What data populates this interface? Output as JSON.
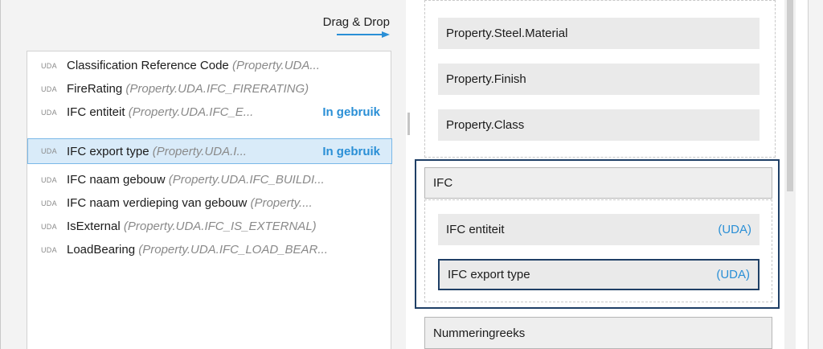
{
  "left_panel": {
    "drag_drop_label": "Drag & Drop",
    "items": [
      {
        "tag": "UDA",
        "name": "Classification Reference Code",
        "prop": " (Property.UDA...",
        "status": ""
      },
      {
        "tag": "UDA",
        "name": "FireRating",
        "prop": " (Property.UDA.IFC_FIRERATING)",
        "status": ""
      },
      {
        "tag": "UDA",
        "name": "IFC entiteit",
        "prop": " (Property.UDA.IFC_E...",
        "status": "In gebruik"
      },
      {
        "tag": "UDA",
        "name": "IFC export type",
        "prop": " (Property.UDA.I...",
        "status": "In gebruik",
        "selected": true
      },
      {
        "tag": "UDA",
        "name": "IFC naam gebouw",
        "prop": " (Property.UDA.IFC_BUILDI...",
        "status": ""
      },
      {
        "tag": "UDA",
        "name": "IFC naam verdieping van gebouw",
        "prop": " (Property....",
        "status": ""
      },
      {
        "tag": "UDA",
        "name": "IsExternal",
        "prop": " (Property.UDA.IFC_IS_EXTERNAL)",
        "status": ""
      },
      {
        "tag": "UDA",
        "name": "LoadBearing",
        "prop": " (Property.UDA.IFC_LOAD_BEAR...",
        "status": ""
      }
    ]
  },
  "right_panel": {
    "top_properties": [
      "Property.Steel.Material",
      "Property.Finish",
      "Property.Class"
    ],
    "ifc_section": {
      "title": "IFC",
      "items": [
        {
          "label": "IFC entiteit",
          "badge": "(UDA)"
        },
        {
          "label": "IFC export type",
          "badge": "(UDA)"
        }
      ]
    },
    "next_section_title": "Nummeringreeks"
  },
  "colors": {
    "accent": "#2a8fd6",
    "highlight_border": "#1f3f66",
    "selected_bg": "#d9ebf9"
  }
}
